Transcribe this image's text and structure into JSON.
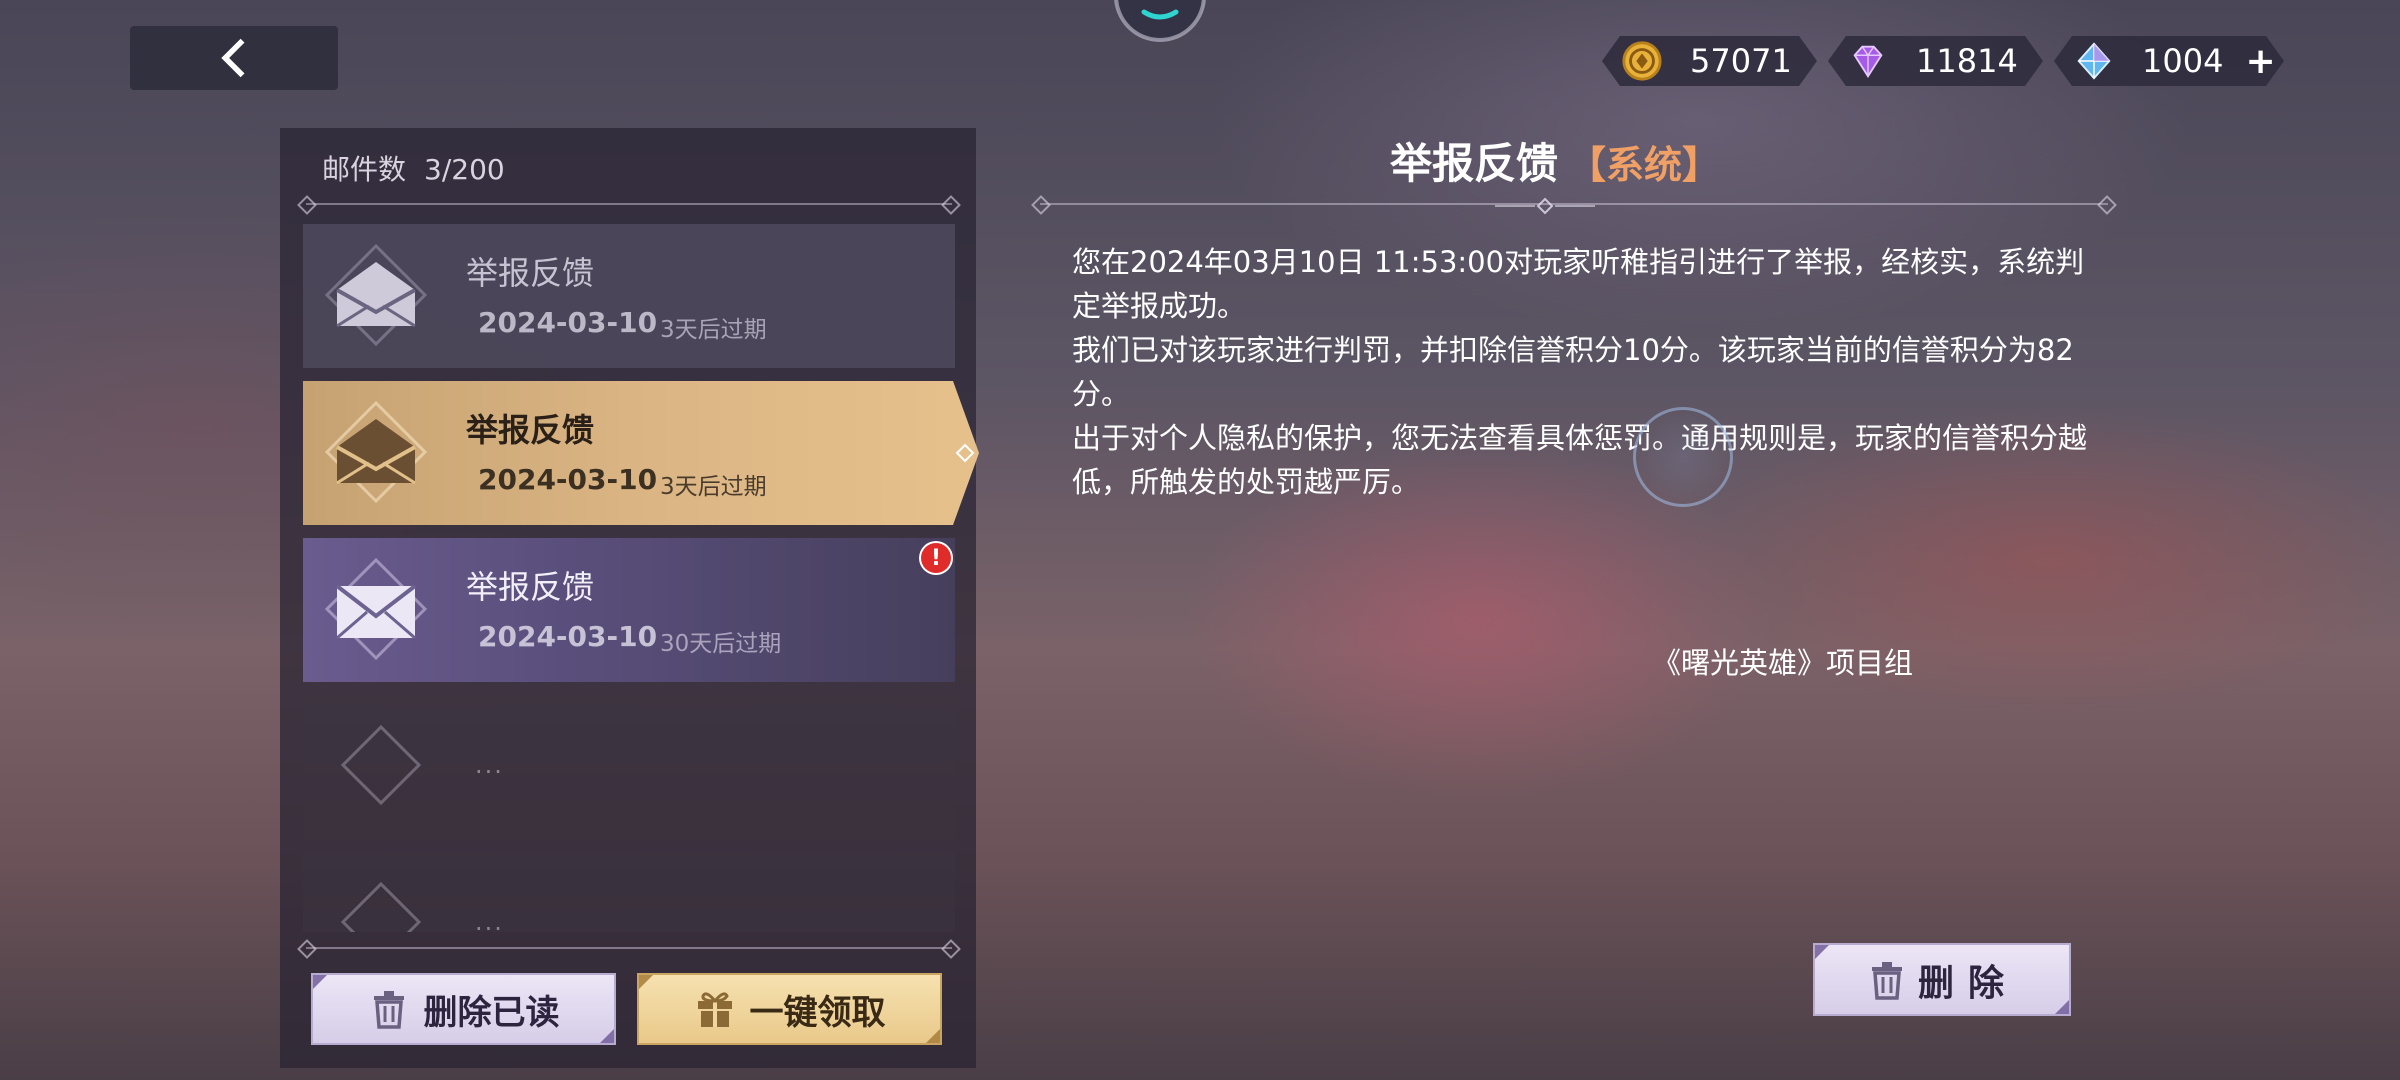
{
  "topbar": {
    "back_icon": "chevron-left-icon",
    "currencies": [
      {
        "name": "gold-coin",
        "icon": "coin-icon",
        "value": "57071"
      },
      {
        "name": "purple-diamond",
        "icon": "purple-gem-icon",
        "value": "11814"
      },
      {
        "name": "blue-diamond",
        "icon": "blue-gem-icon",
        "value": "1004"
      }
    ],
    "add_label": "+"
  },
  "mailbox": {
    "count_label": "邮件数",
    "count_value": "3/200",
    "mails": [
      {
        "title": "举报反馈",
        "date": "2024-03-10",
        "expire": "3天后过期",
        "state": "read"
      },
      {
        "title": "举报反馈",
        "date": "2024-03-10",
        "expire": "3天后过期",
        "state": "selected"
      },
      {
        "title": "举报反馈",
        "date": "2024-03-10",
        "expire": "30天后过期",
        "state": "unread",
        "badge": "!"
      }
    ],
    "empty_dots": "...",
    "buttons": {
      "delete_read": "删除已读",
      "claim_all": "一键领取"
    }
  },
  "detail": {
    "title": "举报反馈",
    "tag": "【系统】",
    "paragraphs": [
      "您在2024年03月10日 11:53:00对玩家听稚指引进行了举报，经核实，系统判定举报成功。",
      "我们已对该玩家进行判罚，并扣除信誉积分10分。该玩家当前的信誉积分为82分。",
      "出于对个人隐私的保护，您无法查看具体惩罚。通用规则是，玩家的信誉积分越低，所触发的处罚越严厉。"
    ],
    "signature": "《曙光英雄》项目组",
    "delete_button": "删除"
  },
  "colors": {
    "selected_mail": "#dab483",
    "unread_mail": "#5a4f7c",
    "tag_orange": "#f0a064",
    "badge_red": "#e02b2b"
  }
}
